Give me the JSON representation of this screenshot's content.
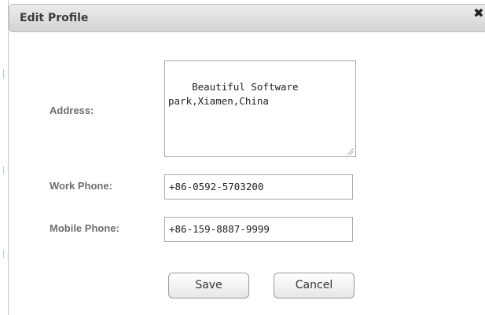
{
  "dialog": {
    "title": "Edit Profile",
    "close_icon": "close-icon"
  },
  "form": {
    "address": {
      "label": "Address:",
      "value": "Beautiful Software\npark,Xiamen,China"
    },
    "work_phone": {
      "label": "Work Phone:",
      "value": "+86-0592-5703200"
    },
    "mobile_phone": {
      "label": "Mobile Phone:",
      "value": "+86-159-8887-9999"
    }
  },
  "actions": {
    "save_label": "Save",
    "cancel_label": "Cancel"
  },
  "colors": {
    "titlebar": "#d9d9d9",
    "label": "#6e6e6e",
    "border": "#a9a9a9"
  }
}
